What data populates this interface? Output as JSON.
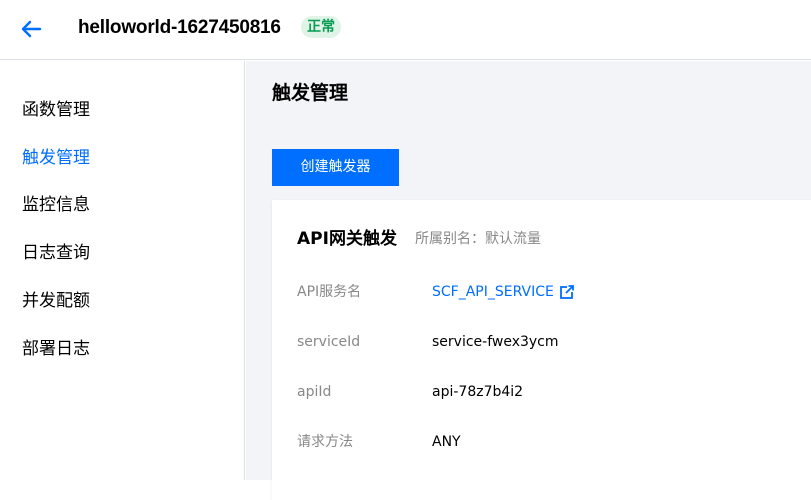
{
  "header": {
    "title": "helloworld-1627450816",
    "status": "正常",
    "back_icon": "arrow-left-icon"
  },
  "sidebar": {
    "items": [
      {
        "label": "函数管理",
        "active": false
      },
      {
        "label": "触发管理",
        "active": true
      },
      {
        "label": "监控信息",
        "active": false
      },
      {
        "label": "日志查询",
        "active": false
      },
      {
        "label": "并发配额",
        "active": false
      },
      {
        "label": "部署日志",
        "active": false
      }
    ]
  },
  "main": {
    "title": "触发管理",
    "create_button": "创建触发器",
    "card": {
      "title": "API网关触发",
      "alias": "所属别名：默认流量",
      "rows": [
        {
          "label": "API服务名",
          "value": "SCF_API_SERVICE",
          "link": true
        },
        {
          "label": "serviceId",
          "value": "service-fwex3ycm"
        },
        {
          "label": "apiId",
          "value": "api-78z7b4i2"
        },
        {
          "label": "请求方法",
          "value": "ANY"
        }
      ]
    }
  },
  "colors": {
    "accent": "#006eff",
    "status_green": "#0a9b53",
    "status_bg": "#dff3e7",
    "muted_text": "#888888",
    "main_bg": "#f3f4f7"
  }
}
